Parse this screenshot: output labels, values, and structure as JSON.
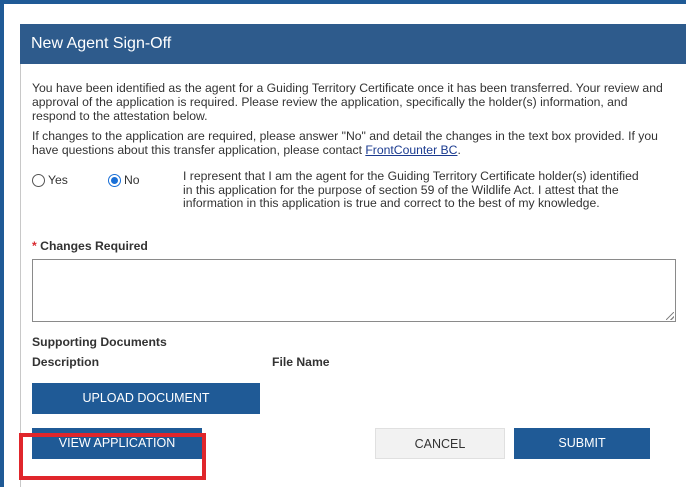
{
  "dialog": {
    "title": "New Agent Sign-Off",
    "intro": "You have been identified as the agent for a Guiding Territory Certificate once it has been transferred. Your review and approval of the application is required. Please review the application, specifically the holder(s) information, and respond to the attestation below.",
    "changes_note_prefix": "If changes to the application are required, please answer \"No\" and detail the changes in the text box provided. If you have questions about this transfer application, please contact ",
    "contact_link": "FrontCounter BC",
    "changes_note_suffix": ".",
    "radio": {
      "yes_label": "Yes",
      "no_label": "No",
      "selected": "No"
    },
    "attestation": "I represent that I am the agent for the Guiding Territory Certificate holder(s) identified in this application for the purpose of section 59 of the Wildlife Act. I attest that the information in this application is true and correct to the best of my knowledge.",
    "changes_required": {
      "required_marker": "*",
      "label": "Changes Required",
      "value": ""
    },
    "supporting_documents": {
      "heading": "Supporting Documents",
      "columns": [
        "Description",
        "File Name"
      ]
    },
    "buttons": {
      "upload": "UPLOAD DOCUMENT",
      "view_application": "VIEW APPLICATION",
      "cancel": "CANCEL",
      "submit": "SUBMIT"
    }
  },
  "colors": {
    "header_bg": "#2e5b8c",
    "primary_button": "#1f5a96",
    "highlight": "#e0262b",
    "link": "#1a3a8f"
  }
}
